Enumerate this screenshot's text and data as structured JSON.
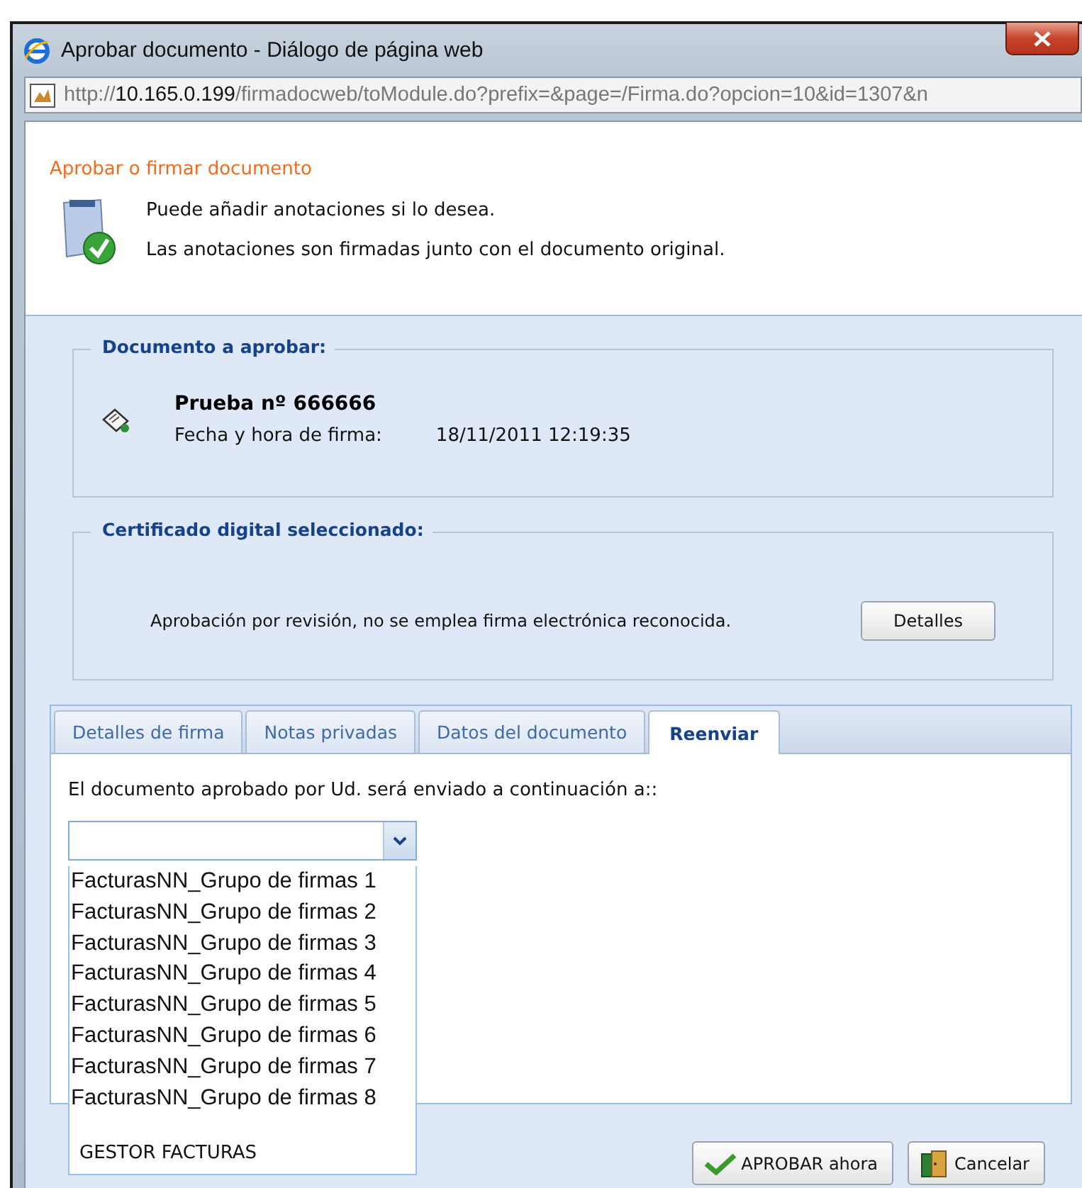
{
  "window": {
    "title": "Aprobar documento - Diálogo de página web",
    "address": {
      "scheme": "http://",
      "host": "10.165.0.199",
      "path": "/firmadocweb/toModule.do?prefix=&page=/Firma.do?opcion=10&id=1307&n"
    }
  },
  "header": {
    "title": "Aprobar o firmar documento",
    "lines": [
      "Puede añadir anotaciones si lo desea.",
      "Las anotaciones son firmadas junto con el documento original."
    ]
  },
  "document_panel": {
    "legend": "Documento a aprobar:",
    "name": "Prueba nº 666666",
    "date_label": "Fecha y hora de firma:",
    "date_value": "18/11/2011 12:19:35"
  },
  "certificate_panel": {
    "legend": "Certificado digital seleccionado:",
    "text": "Aprobación por revisión, no se emplea firma electrónica reconocida.",
    "button": "Detalles"
  },
  "tabs": [
    {
      "label": "Detalles de firma",
      "selected": false
    },
    {
      "label": "Notas privadas",
      "selected": false
    },
    {
      "label": "Datos del documento",
      "selected": false
    },
    {
      "label": "Reenviar",
      "selected": true
    }
  ],
  "forward": {
    "label": "El documento aprobado por Ud. será enviado a continuación a::",
    "dropdown": {
      "expanded": true,
      "options": [
        {
          "label": "FacturasNN_Grupo de firmas 1",
          "kind": "item"
        },
        {
          "label": "FacturasNN_Grupo de firmas 2",
          "kind": "item"
        },
        {
          "label": "FacturasNN_Grupo de firmas 3",
          "kind": "item"
        },
        {
          "label": "FacturasNN_Grupo de firmas 4",
          "kind": "item"
        },
        {
          "label": "FacturasNN_Grupo de firmas 5",
          "kind": "item"
        },
        {
          "label": "FacturasNN_Grupo de firmas 6",
          "kind": "item"
        },
        {
          "label": "FacturasNN_Grupo de firmas 7",
          "kind": "item"
        },
        {
          "label": "FacturasNN_Grupo de firmas 8",
          "kind": "item"
        },
        {
          "label": "GESTOR FACTURAS",
          "kind": "group"
        }
      ]
    }
  },
  "buttons": [
    {
      "label": "APROBAR ahora",
      "kind": "approve"
    },
    {
      "label": "Cancelar",
      "kind": "cancel"
    }
  ]
}
